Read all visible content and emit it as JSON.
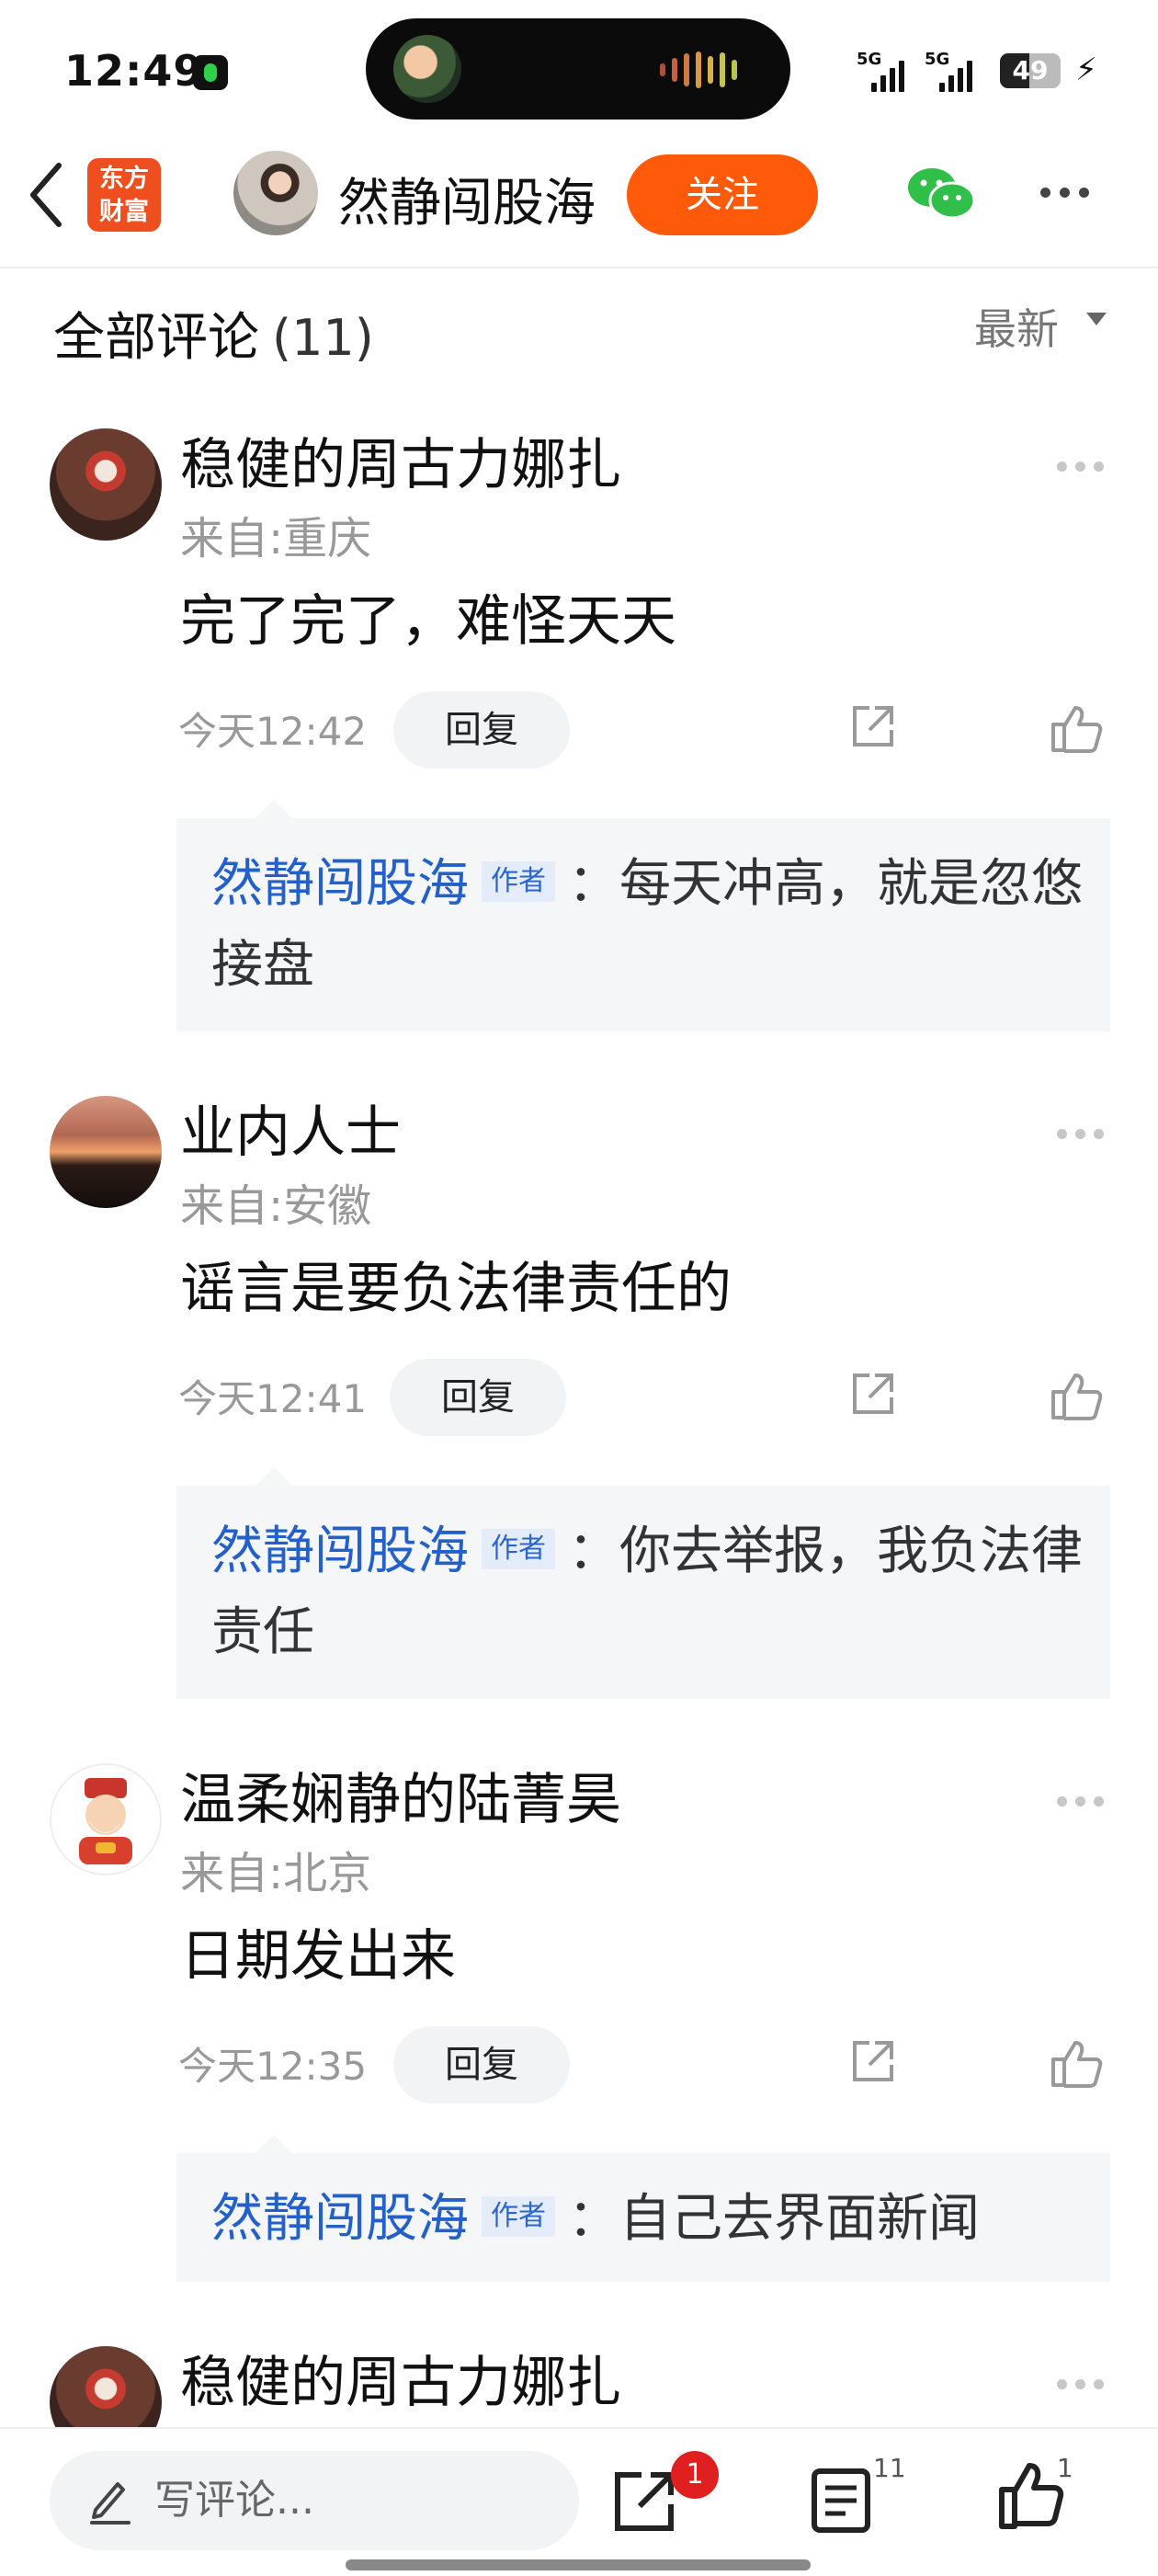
{
  "status": {
    "time": "12:49",
    "network1": "5G",
    "network2": "5G",
    "battery": "49",
    "battery_level": 0.49
  },
  "header": {
    "brand_line1": "东方",
    "brand_line2": "财富",
    "author_name": "然静闯股海",
    "follow_label": "关注"
  },
  "comments_section": {
    "title": "全部评论",
    "count": "(11)",
    "sort_label": "最新"
  },
  "comments": [
    {
      "user": "稳健的周古力娜扎",
      "location": "来自:重庆",
      "text": "完了完了，难怪天天",
      "time": "今天12:42",
      "reply_label": "回复",
      "reply": {
        "author": "然静闯股海",
        "badge": "作者",
        "text": "：每天冲高，就是忽悠接盘"
      }
    },
    {
      "user": "业内人士",
      "location": "来自:安徽",
      "text": "谣言是要负法律责任的",
      "time": "今天12:41",
      "reply_label": "回复",
      "reply": {
        "author": "然静闯股海",
        "badge": "作者",
        "text": "：你去举报，我负法律责任"
      }
    },
    {
      "user": "温柔娴静的陆菁昊",
      "location": "来自:北京",
      "text": "日期发出来",
      "time": "今天12:35",
      "reply_label": "回复",
      "reply": {
        "author": "然静闯股海",
        "badge": "作者",
        "text": "：自己去界面新闻"
      }
    },
    {
      "user": "稳健的周古力娜扎"
    }
  ],
  "bottom_bar": {
    "placeholder": "写评论...",
    "share_badge": "1",
    "comment_count": "11",
    "like_count": "1"
  }
}
